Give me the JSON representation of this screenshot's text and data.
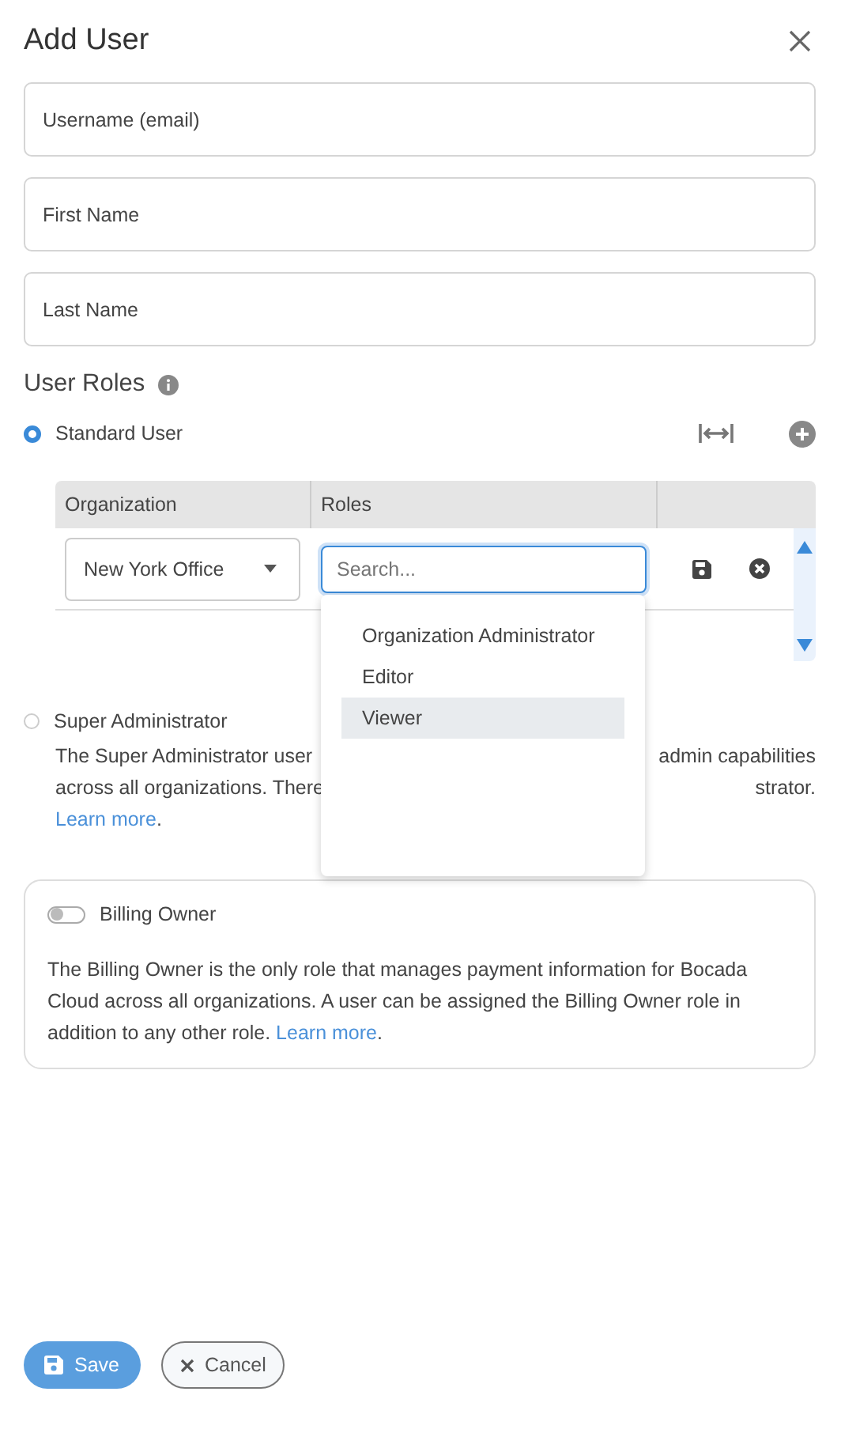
{
  "dialog": {
    "title": "Add User"
  },
  "fields": [
    {
      "placeholder": "Username (email)"
    },
    {
      "placeholder": "First Name"
    },
    {
      "placeholder": "Last Name"
    }
  ],
  "user_roles": {
    "heading": "User Roles",
    "standard_option": {
      "label": "Standard User",
      "selected": true
    },
    "table": {
      "columns": [
        "Organization",
        "Roles"
      ],
      "rows": [
        {
          "organization": "New York Office",
          "roles_placeholder": "Search..."
        }
      ]
    },
    "roles_dropdown": {
      "items": [
        {
          "label": "Organization Administrator",
          "selected": false
        },
        {
          "label": "Editor",
          "selected": false
        },
        {
          "label": "Viewer",
          "selected": true
        }
      ]
    },
    "super_option": {
      "label": "Super Administrator",
      "selected": false,
      "description_lines": [
        {
          "left": "The Super Administrator user",
          "right": "admin capabilities"
        },
        {
          "left": "across all organizations. There",
          "right": "strator."
        }
      ],
      "link": "Learn more",
      "trailing": "."
    }
  },
  "billing_owner": {
    "label": "Billing Owner",
    "on": false,
    "description": "The Billing Owner is the only role that manages payment information for Bocada Cloud across all organizations. A user can be assigned the Billing Owner role in addition to any other role.",
    "link": "Learn more",
    "trailing": "."
  },
  "buttons": [
    {
      "label": "Save",
      "kind": "primary"
    },
    {
      "label": "Cancel",
      "kind": "secondary"
    }
  ]
}
